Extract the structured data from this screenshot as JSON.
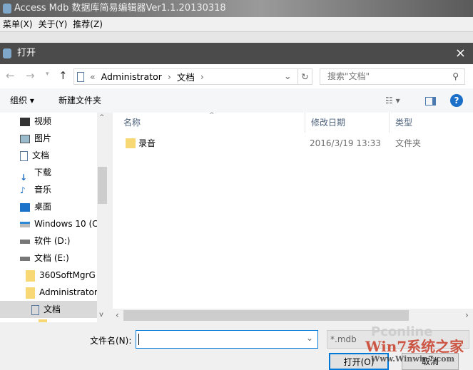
{
  "app": {
    "title": "Access Mdb 数据库简易编辑器Ver1.1.20130318",
    "menu": [
      "菜单(X)",
      "关于(Y)",
      "推荐(Z)"
    ]
  },
  "dialog": {
    "title": "打开",
    "close": "×"
  },
  "nav": {
    "breadcrumb": [
      "«",
      "Administrator",
      "›",
      "文档",
      "›"
    ],
    "search_placeholder": "搜索\"文档\""
  },
  "toolbar": {
    "organize": "组织 ▾",
    "new_folder": "新建文件夹"
  },
  "sidebar": {
    "items": [
      "视频",
      "图片",
      "文档",
      "下载",
      "音乐",
      "桌面",
      "Windows 10 (C",
      "软件 (D:)",
      "文档 (E:)",
      "360SoftMgrG",
      "Administrator",
      "文档"
    ]
  },
  "list": {
    "columns": [
      "名称",
      "修改日期",
      "类型"
    ],
    "rows": [
      {
        "name": "录音",
        "date": "2016/3/19 13:33",
        "type": "文件夹"
      }
    ]
  },
  "bottom": {
    "filename_label": "文件名(N):",
    "filename_value": "",
    "filter": "*.mdb",
    "open": "打开(O)",
    "cancel": "取消"
  },
  "watermark": {
    "text1": "Pconline",
    "text2": "Win7系统之家",
    "text3": "Www.Winwin7.com"
  }
}
